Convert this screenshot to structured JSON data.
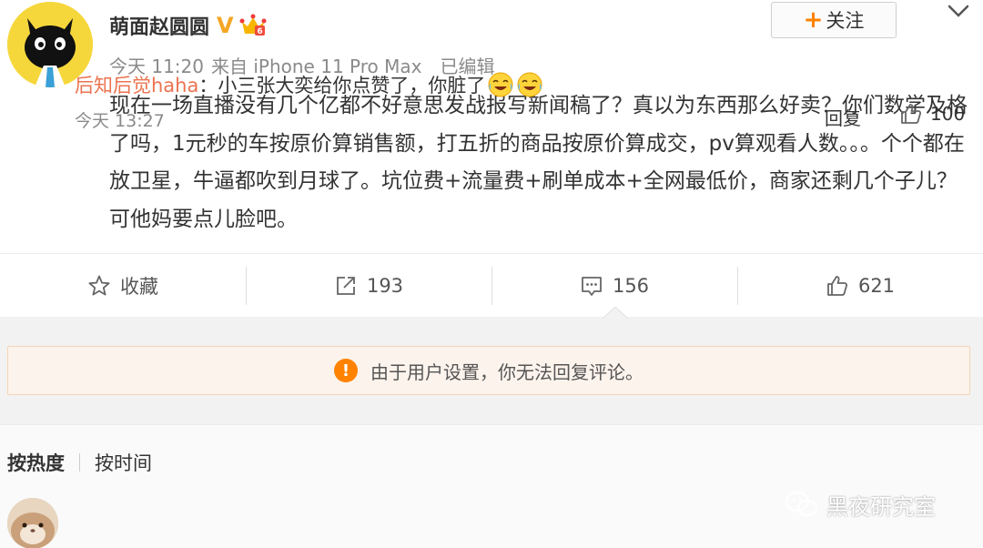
{
  "post": {
    "author": "萌面赵圆圆",
    "verified_mark": "V",
    "meta": {
      "time": "今天 11:20",
      "source": "来自 iPhone 11 Pro Max",
      "edited": "已编辑"
    },
    "follow_label": "关注",
    "content": "现在一场直播没有几个亿都不好意思发战报写新闻稿了？真以为东西那么好卖？你们数学及格了吗，1元秒的车按原价算销售额，打五折的商品按原价算成交，pv算观看人数。。。个个都在放卫星，牛逼都吹到月球了。坑位费+流量费+刷单成本+全网最低价，商家还剩几个子儿？可他妈要点儿脸吧。"
  },
  "actions": {
    "favorite_label": "收藏",
    "repost_count": "193",
    "comment_count": "156",
    "like_count": "621"
  },
  "notice": {
    "text": "由于用户设置，你无法回复评论。"
  },
  "comments": {
    "sort_hot": "按热度",
    "sort_time": "按时间",
    "items": [
      {
        "user": "后知后觉haha",
        "text": "：小三张大奕给你点赞了，你脏了",
        "time": "今天 13:27",
        "reply_label": "回复",
        "likes": "100"
      }
    ]
  },
  "watermark": "黑夜研究室",
  "colors": {
    "accent_orange": "#ff8200",
    "username_link": "#eb7350",
    "notice_bg": "#fcf3ec",
    "verified_gold": "#f5a623"
  },
  "icons": [
    "star-icon",
    "repost-icon",
    "comment-icon",
    "thumbs-up-icon",
    "chevron-down-icon",
    "warning-icon",
    "laugh-cry-emoji",
    "wechat-icon"
  ]
}
